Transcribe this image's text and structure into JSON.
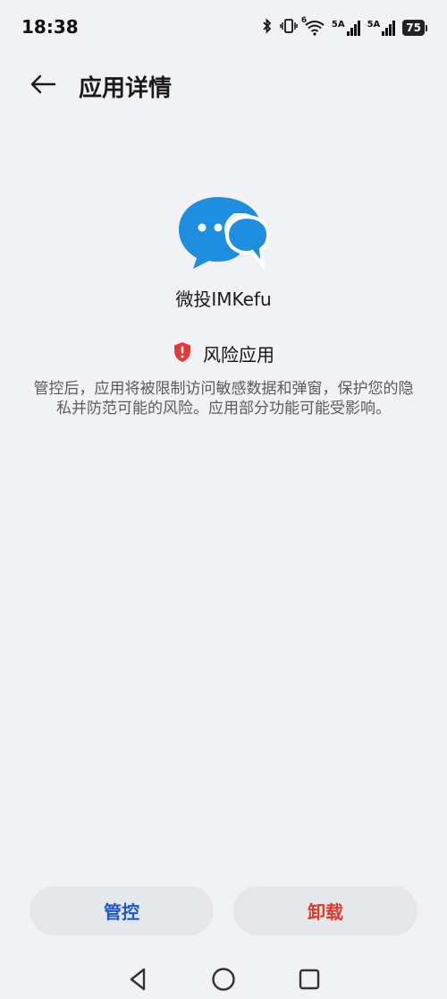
{
  "status_bar": {
    "time": "18:38",
    "network_1": "5A",
    "network_2": "5A",
    "wifi_label": "6",
    "battery": "75"
  },
  "header": {
    "title": "应用详情",
    "back_icon": "arrow-left-icon"
  },
  "app": {
    "name": "微投IMKefu",
    "icon": "chat-bubbles-icon",
    "icon_color": "#1e8fe0"
  },
  "risk": {
    "label": "风险应用",
    "icon": "shield-alert-icon",
    "color": "#e53935",
    "description": "管控后，应用将被限制访问敏感数据和弹窗，保护您的隐私并防范可能的风险。应用部分功能可能受影响。"
  },
  "actions": {
    "manage_label": "管控",
    "manage_color": "#1f57c9",
    "uninstall_label": "卸载",
    "uninstall_color": "#e03a2c"
  },
  "nav": {
    "back_icon": "triangle-back-icon",
    "home_icon": "circle-home-icon",
    "recent_icon": "square-recent-icon"
  }
}
